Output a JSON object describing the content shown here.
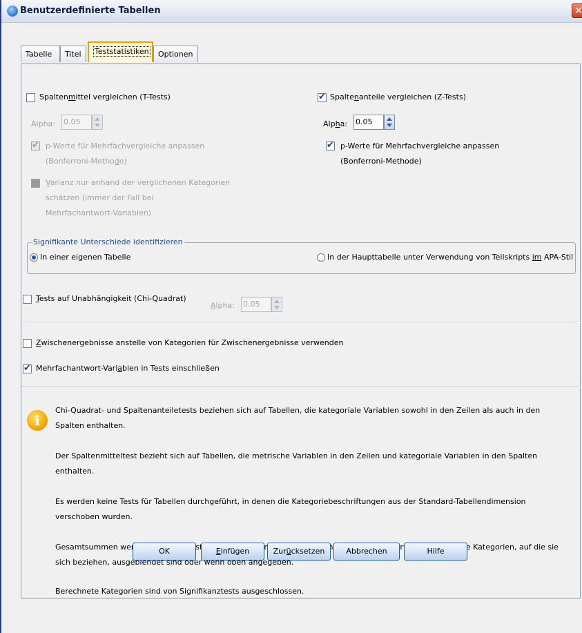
{
  "window": {
    "title": "Benutzerdefinierte Tabellen",
    "close_glyph": "✕"
  },
  "tabs": [
    {
      "label": "Tabelle"
    },
    {
      "label": "Titel"
    },
    {
      "label": "Teststatistiken",
      "active": true
    },
    {
      "label": "Optionen"
    }
  ],
  "left": {
    "means_label_pre": "Spalten",
    "means_label_u": "m",
    "means_label_post": "ittel vergleichen (T-Tests)",
    "means_checked": false,
    "alpha_label": "Alpha:",
    "alpha_value": "0.05",
    "adjust_line1": "p-Werte für Mehrfachvergleiche anpassen",
    "adjust_line2_pre": "(Bonferroni-Metho",
    "adjust_line2_u": "d",
    "adjust_line2_post": "e)",
    "variance_line1_u": "V",
    "variance_line1": "arianz nur anhand der verglichenen Kategorien",
    "variance_line2": "schätzen (immer der Fall bei",
    "variance_line3": "Mehrfachantwort-Variablen)"
  },
  "right": {
    "props_label_pre": "Spalte",
    "props_label_u": "n",
    "props_label_post": "anteile vergleichen (Z-Tests)",
    "props_checked": true,
    "alpha_label_pre": "Alp",
    "alpha_label_u": "h",
    "alpha_label_post": "a:",
    "alpha_value": "0.05",
    "adjust_line1": "p-Werte für Mehrfachvergleiche anpassen",
    "adjust_line2": "(Bonferroni-Methode)",
    "adjust_checked": true
  },
  "significance": {
    "legend": "Signifikante Unterschiede identifizieren",
    "opt_separate": "In einer eigenen Tabelle",
    "opt_main_pre": "In der Haupttabelle unter Verwendung von Teilskripts ",
    "opt_main_u": "im",
    "opt_main_post": " APA-Stil",
    "selected": "separate"
  },
  "independence": {
    "label_u": "T",
    "label": "ests auf Unabhängigkeit (Chi-Quadrat)",
    "checked": false,
    "alpha_label_u": "A",
    "alpha_label": "lpha:",
    "alpha_value": "0.05"
  },
  "subtotals": {
    "label_u": "Z",
    "label": "wischenergebnisse anstelle von Kategorien für Zwischenergebnisse verwenden",
    "checked": false
  },
  "multiresponse": {
    "label_pre": "Mehrfachantwort-Vari",
    "label_u": "a",
    "label_post": "blen in Tests einschließen",
    "checked": true
  },
  "info": {
    "icon": "info-icon",
    "p1": "Chi-Quadrat- und Spaltenanteiletests beziehen sich auf Tabellen, die kategoriale Variablen sowohl in den Zeilen als auch in den Spalten enthalten.",
    "p2": "Der Spaltenmitteltest bezieht sich auf Tabellen, die metrische Variablen in den Zeilen und kategoriale Variablen in den Spalten enthalten.",
    "p3": "Es werden keine Tests für Tabellen durchgeführt, in denen die Kategoriebeschriftungen aus der Standard-Tabellendimension verschoben wurden.",
    "p4": "Gesamtsummen werden aus allen Tests ausgeschlossen. Zwischensummen werden nur verwendet, wenn die Kategorien, auf die sie sich beziehen, ausgeblendet sind oder wenn oben angegeben.",
    "p5": "Berechnete Kategorien sind von Signifikanztests ausgeschlossen."
  },
  "buttons": {
    "ok": "OK",
    "paste_u": "E",
    "paste": "infügen",
    "reset_pre": "Zur",
    "reset_u": "ü",
    "reset_post": "cksetzen",
    "cancel": "Abbrechen",
    "help": "Hilfe"
  }
}
